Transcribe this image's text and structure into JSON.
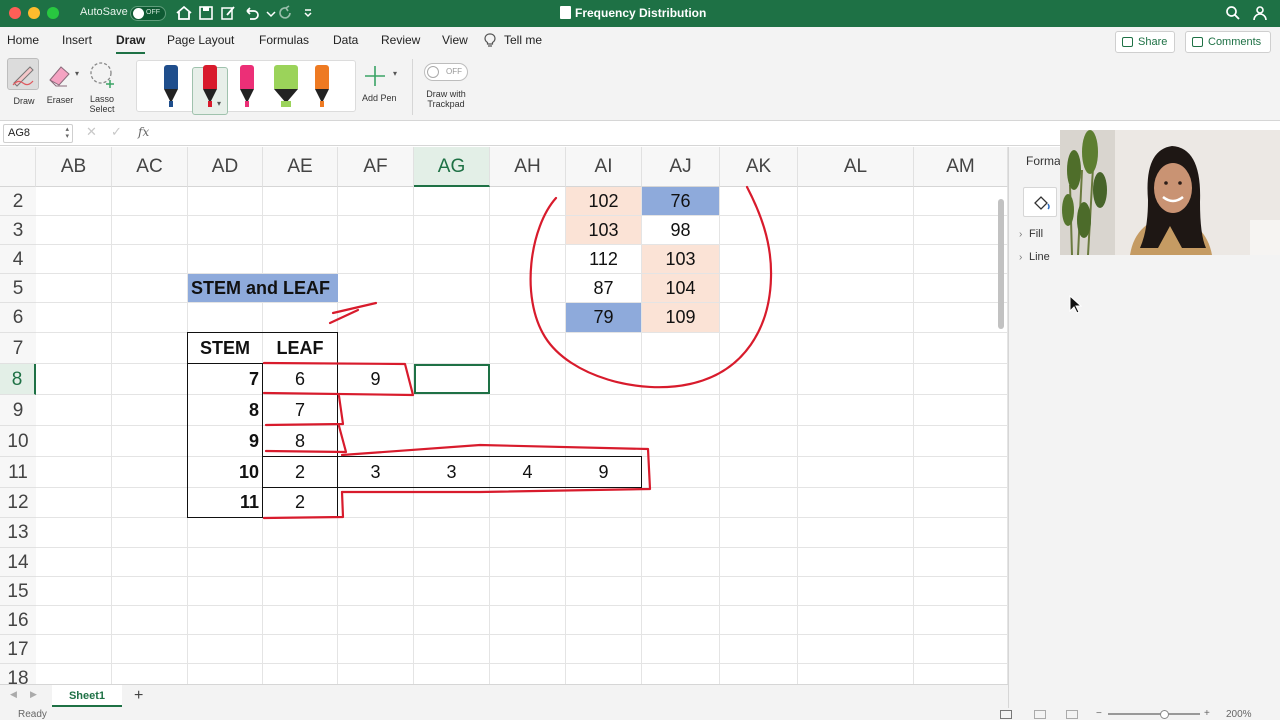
{
  "titlebar": {
    "autosave_label": "AutoSave",
    "autosave_state": "OFF",
    "document_title": "Frequency Distribution",
    "accent_color": "#1e7145"
  },
  "tabs": [
    "Home",
    "Insert",
    "Draw",
    "Page Layout",
    "Formulas",
    "Data",
    "Review",
    "View"
  ],
  "active_tab": "Draw",
  "tell_me": "Tell me",
  "share_label": "Share",
  "comments_label": "Comments",
  "ribbon": {
    "draw_label": "Draw",
    "eraser_label": "Eraser",
    "lasso_label": [
      "Lasso",
      "Select"
    ],
    "add_pen_label": "Add Pen",
    "trackpad_toggle_state": "OFF",
    "trackpad_label": [
      "Draw with",
      "Trackpad"
    ],
    "pens": [
      {
        "name": "blue-pen-icon",
        "color": "#1f4e8c"
      },
      {
        "name": "red-pen-icon",
        "color": "#d81b2c",
        "selected": true
      },
      {
        "name": "pink-pen-icon",
        "color": "#ec2f77"
      },
      {
        "name": "green-highlighter-icon",
        "color": "#9bd35a"
      },
      {
        "name": "orange-pen-icon",
        "color": "#ee7a22"
      }
    ]
  },
  "formula_bar": {
    "name_box": "AG8",
    "fx_label": "fx",
    "value": ""
  },
  "grid": {
    "columns": [
      "AB",
      "AC",
      "AD",
      "AE",
      "AF",
      "AG",
      "AH",
      "AI",
      "AJ",
      "AK",
      "AL",
      "AM"
    ],
    "selected_column": "AG",
    "rows": [
      "2",
      "3",
      "4",
      "5",
      "6",
      "7",
      "8",
      "9",
      "10",
      "11",
      "12",
      "13",
      "14",
      "15",
      "16",
      "17",
      "18"
    ],
    "selected_row": "8",
    "title_cell": "STEM and LEAF",
    "table_headers": [
      "STEM",
      "LEAF"
    ],
    "stems": [
      "7",
      "8",
      "9",
      "10",
      "11"
    ],
    "leaves": [
      [
        "6",
        "9"
      ],
      [
        "7"
      ],
      [
        "8"
      ],
      [
        "2",
        "3",
        "3",
        "4",
        "9"
      ],
      [
        "2"
      ]
    ],
    "data_ai": [
      "102",
      "103",
      "112",
      "87",
      "79"
    ],
    "data_aj": [
      "76",
      "98",
      "103",
      "104",
      "109"
    ],
    "highlight_blue": "#8eaadb",
    "highlight_peach": "#fbe3d6",
    "title_fill": "#8eaadb",
    "ink_color": "#d81b2c"
  },
  "sheet_tab": "Sheet1",
  "status": "Ready",
  "zoom": "200%",
  "format_pane": {
    "title": "Forma",
    "sections": [
      "Fill",
      "Line"
    ]
  }
}
